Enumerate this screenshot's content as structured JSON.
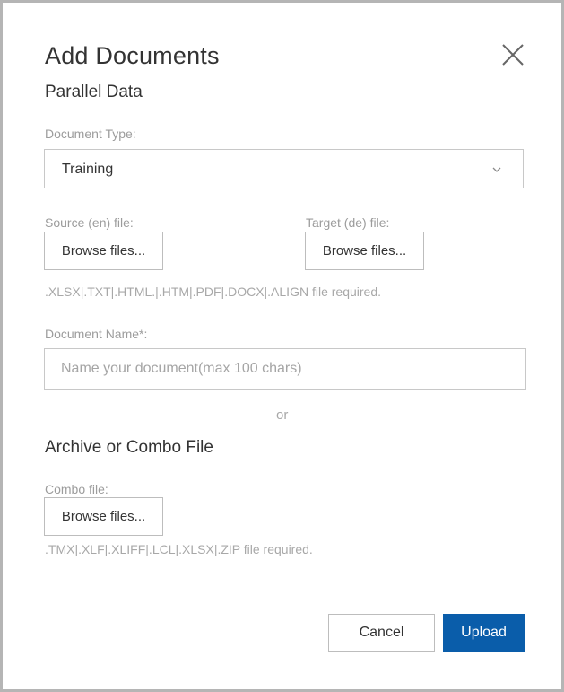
{
  "dialog": {
    "title": "Add Documents",
    "subtitle": "Parallel Data"
  },
  "document_type": {
    "label": "Document Type:",
    "selected": "Training"
  },
  "source_file": {
    "label": "Source (en) file:",
    "button": "Browse files..."
  },
  "target_file": {
    "label": "Target (de) file:",
    "button": "Browse files..."
  },
  "parallel_hint": ".XLSX|.TXT|.HTML.|.HTM|.PDF|.DOCX|.ALIGN file required.",
  "document_name": {
    "label": "Document Name*:",
    "value": "",
    "placeholder": "Name your document(max 100 chars)"
  },
  "divider": {
    "text": "or"
  },
  "archive": {
    "title": "Archive or Combo File",
    "combo_label": "Combo file:",
    "button": "Browse files...",
    "hint": ".TMX|.XLF|.XLIFF|.LCL|.XLSX|.ZIP file required."
  },
  "footer": {
    "cancel": "Cancel",
    "upload": "Upload"
  },
  "colors": {
    "accent": "#0a5daa",
    "label": "#9c9c9c",
    "text": "#333333",
    "border": "#c8c8c8"
  },
  "icons": {
    "close": "close-icon",
    "dropdown": "chevron-down-icon"
  }
}
